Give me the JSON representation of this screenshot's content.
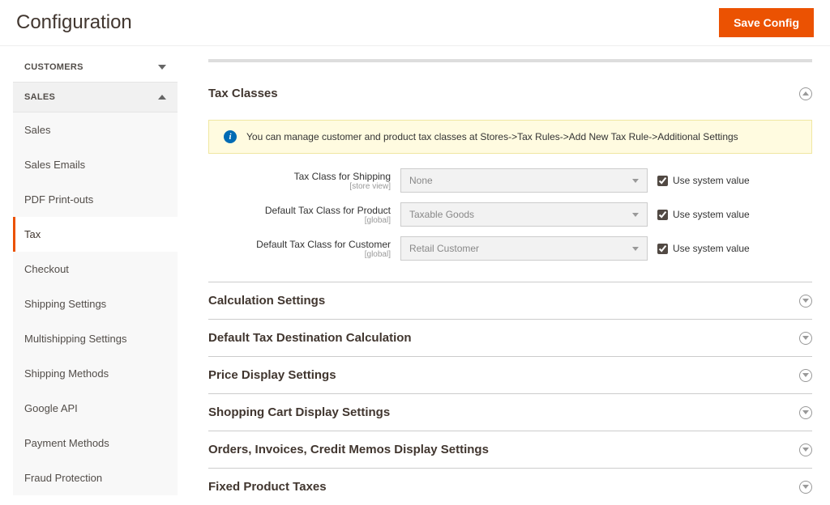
{
  "header": {
    "title": "Configuration",
    "save_label": "Save Config"
  },
  "sidebar": {
    "sections": [
      {
        "label": "CUSTOMERS",
        "expanded": false
      },
      {
        "label": "SALES",
        "expanded": true,
        "items": [
          "Sales",
          "Sales Emails",
          "PDF Print-outs",
          "Tax",
          "Checkout",
          "Shipping Settings",
          "Multishipping Settings",
          "Shipping Methods",
          "Google API",
          "Payment Methods",
          "Fraud Protection"
        ],
        "active_index": 3
      }
    ]
  },
  "panels": {
    "tax_classes": {
      "title": "Tax Classes",
      "info": "You can manage customer and product tax classes at Stores->Tax Rules->Add New Tax Rule->Additional Settings",
      "fields": [
        {
          "label": "Tax Class for Shipping",
          "scope": "[store view]",
          "value": "None",
          "use_system_label": "Use system value"
        },
        {
          "label": "Default Tax Class for Product",
          "scope": "[global]",
          "value": "Taxable Goods",
          "use_system_label": "Use system value"
        },
        {
          "label": "Default Tax Class for Customer",
          "scope": "[global]",
          "value": "Retail Customer",
          "use_system_label": "Use system value"
        }
      ]
    },
    "others": [
      "Calculation Settings",
      "Default Tax Destination Calculation",
      "Price Display Settings",
      "Shopping Cart Display Settings",
      "Orders, Invoices, Credit Memos Display Settings",
      "Fixed Product Taxes"
    ]
  }
}
